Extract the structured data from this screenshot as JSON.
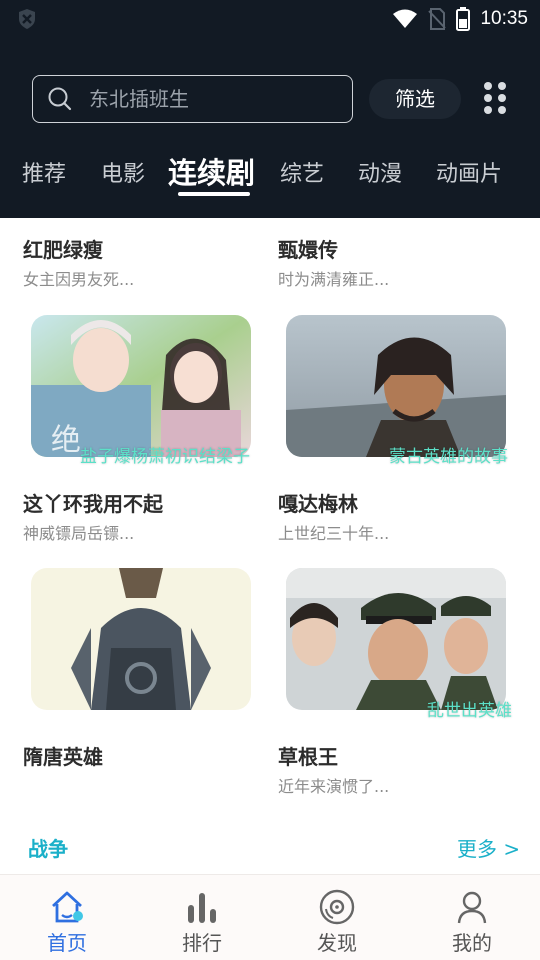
{
  "status_bar": {
    "time": "10:35"
  },
  "search": {
    "placeholder": "东北插班生"
  },
  "filter_label": "筛选",
  "tabs": [
    {
      "label": "推荐",
      "active": false
    },
    {
      "label": "电影",
      "active": false
    },
    {
      "label": "连续剧",
      "active": true
    },
    {
      "label": "综艺",
      "active": false
    },
    {
      "label": "动漫",
      "active": false
    },
    {
      "label": "动画片",
      "active": false
    }
  ],
  "items": [
    {
      "title": "红肥绿瘦",
      "desc": "女主因男友死..."
    },
    {
      "title": "甄嬛传",
      "desc": "时为满清雍正..."
    },
    {
      "title": "这丫环我用不起",
      "desc": "神威镖局岳镖...",
      "caption": "盐子爆杨萧初识结梁子"
    },
    {
      "title": "嘎达梅林",
      "desc": "上世纪三十年...",
      "caption": "蒙古英雄的故事"
    },
    {
      "title": "隋唐英雄",
      "desc": ""
    },
    {
      "title": "草根王",
      "desc": "近年来演惯了...",
      "caption": "乱世出英雄"
    }
  ],
  "section": {
    "title": "战争",
    "more": "更多 >"
  },
  "bottom_nav": [
    {
      "label": "首页",
      "icon": "home-icon",
      "active": true
    },
    {
      "label": "排行",
      "icon": "bar-chart-icon",
      "active": false
    },
    {
      "label": "发现",
      "icon": "disc-icon",
      "active": false
    },
    {
      "label": "我的",
      "icon": "user-icon",
      "active": false
    }
  ],
  "colors": {
    "header_bg": "#121a24",
    "accent": "#1bb0c9",
    "nav_active": "#2f6fe0",
    "caption": "#5ce0c8"
  }
}
